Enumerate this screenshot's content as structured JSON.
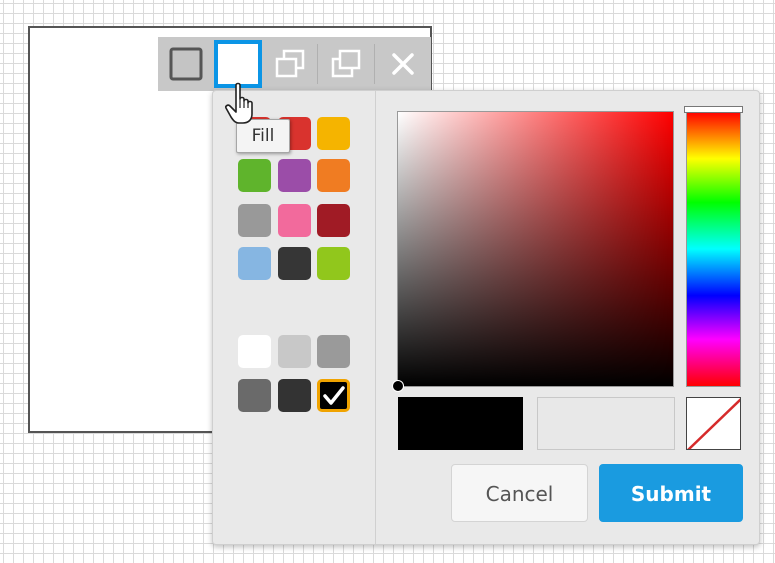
{
  "toolbar": {
    "buttons": [
      {
        "name": "Shape style",
        "icon": "shape-square-icon"
      },
      {
        "name": "Fill",
        "icon": "fill-square-icon",
        "active": true
      },
      {
        "name": "Bring forward",
        "icon": "bring-forward-icon"
      },
      {
        "name": "Send backward",
        "icon": "send-backward-icon"
      },
      {
        "name": "Delete",
        "icon": "close-icon"
      }
    ]
  },
  "tooltip": {
    "text": "Fill"
  },
  "palette": {
    "colors": [
      "#d9332e",
      "#d9332e",
      "#f5b400",
      "#5fb42c",
      "#9b4da8",
      "#f07c22",
      "#999999",
      "#f26a9c",
      "#a01b25",
      "#86b6e2",
      "#363636",
      "#91c71c"
    ],
    "grays": [
      "#ffffff",
      "#c8c8c8",
      "#9a9a9a",
      "#6a6a6a",
      "#333333",
      "#000000"
    ],
    "selected_color": "#000000"
  },
  "picker": {
    "hue": "#ff0000",
    "current_color": "#000000",
    "cancel_label": "Cancel",
    "submit_label": "Submit",
    "accent_color": "#1a9be0",
    "selected_border_color": "#f0a300"
  }
}
